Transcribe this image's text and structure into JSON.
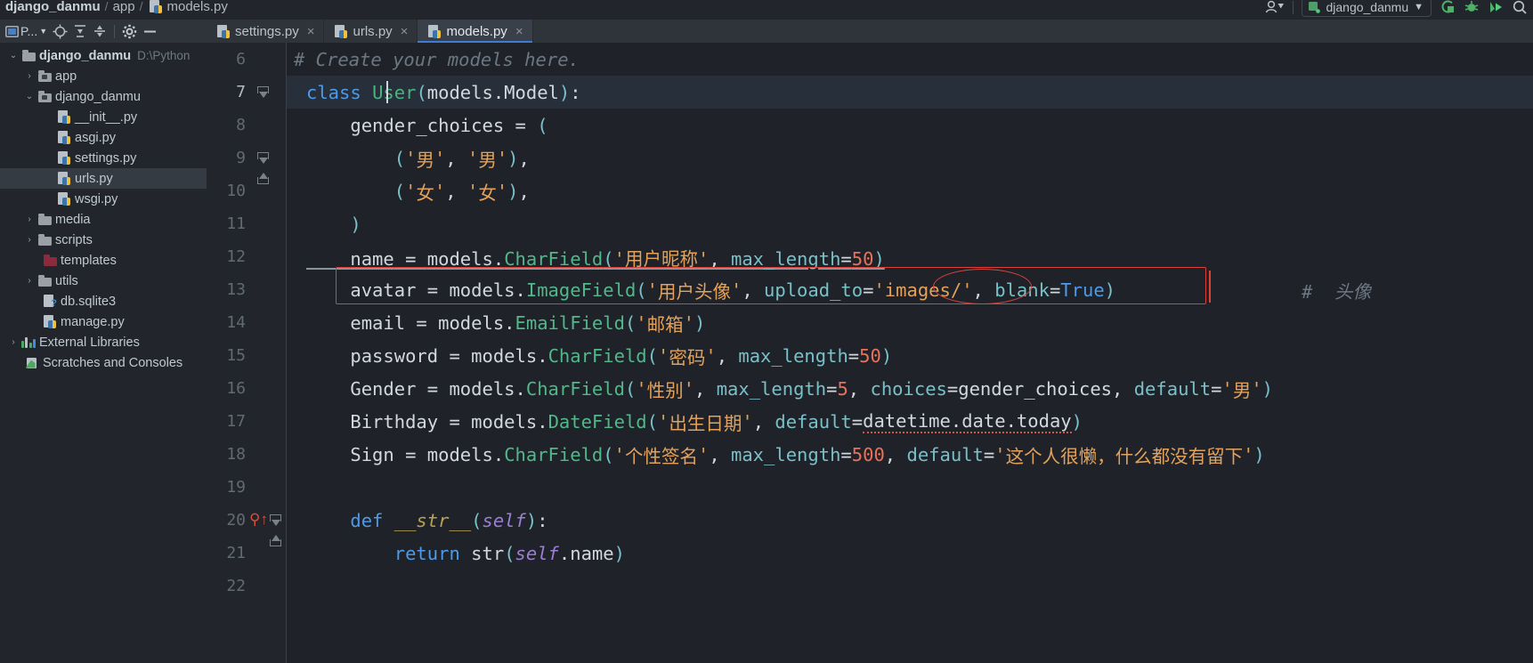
{
  "window": {
    "breadcrumb": [
      "django_danmu",
      "app",
      "models.py"
    ],
    "run_config": "django_danmu",
    "icons": [
      "avatar-icon",
      "chevron-down-icon",
      "coverage-icon",
      "debug-icon",
      "run-icon",
      "search-icon"
    ]
  },
  "project_panel": {
    "title": "P...",
    "buttons": [
      "project-view-selector",
      "locate-icon",
      "expand-all-icon",
      "collapse-all-icon",
      "settings-gear-icon",
      "hide-panel-icon"
    ]
  },
  "tabs": [
    {
      "label": "settings.py",
      "icon": "python-file-icon",
      "active": false,
      "close": "×"
    },
    {
      "label": "urls.py",
      "icon": "python-file-icon",
      "active": false,
      "close": "×"
    },
    {
      "label": "models.py",
      "icon": "python-file-icon",
      "active": true,
      "close": "×"
    }
  ],
  "tree": [
    {
      "label": "django_danmu",
      "path": "D:\\Python",
      "icon": "folder-icon",
      "arrow": "⌄",
      "indent": 8,
      "bold": true,
      "selected": false
    },
    {
      "label": "app",
      "path": "",
      "icon": "folder-source-icon",
      "arrow": "›",
      "indent": 26,
      "bold": false,
      "selected": false
    },
    {
      "label": "django_danmu",
      "path": "",
      "icon": "folder-source-icon",
      "arrow": "⌄",
      "indent": 26,
      "bold": false,
      "selected": false
    },
    {
      "label": "__init__.py",
      "path": "",
      "icon": "python-file-icon",
      "arrow": "",
      "indent": 58,
      "bold": false,
      "selected": false
    },
    {
      "label": "asgi.py",
      "path": "",
      "icon": "python-file-icon",
      "arrow": "",
      "indent": 58,
      "bold": false,
      "selected": false
    },
    {
      "label": "settings.py",
      "path": "",
      "icon": "python-file-icon",
      "arrow": "",
      "indent": 58,
      "bold": false,
      "selected": false
    },
    {
      "label": "urls.py",
      "path": "",
      "icon": "python-file-icon",
      "arrow": "",
      "indent": 58,
      "bold": false,
      "selected": true
    },
    {
      "label": "wsgi.py",
      "path": "",
      "icon": "python-file-icon",
      "arrow": "",
      "indent": 58,
      "bold": false,
      "selected": false
    },
    {
      "label": "media",
      "path": "",
      "icon": "folder-icon",
      "arrow": "›",
      "indent": 26,
      "bold": false,
      "selected": false
    },
    {
      "label": "scripts",
      "path": "",
      "icon": "folder-icon",
      "arrow": "›",
      "indent": 26,
      "bold": false,
      "selected": false
    },
    {
      "label": "templates",
      "path": "",
      "icon": "folder-template-icon",
      "arrow": "",
      "indent": 42,
      "bold": false,
      "selected": false
    },
    {
      "label": "utils",
      "path": "",
      "icon": "folder-icon",
      "arrow": "›",
      "indent": 26,
      "bold": false,
      "selected": false
    },
    {
      "label": "db.sqlite3",
      "path": "",
      "icon": "unknown-file-icon",
      "arrow": "",
      "indent": 42,
      "bold": false,
      "selected": false
    },
    {
      "label": "manage.py",
      "path": "",
      "icon": "python-file-icon",
      "arrow": "",
      "indent": 42,
      "bold": false,
      "selected": false
    },
    {
      "label": "External Libraries",
      "path": "",
      "icon": "library-icon",
      "arrow": "›",
      "indent": 8,
      "bold": false,
      "selected": false
    },
    {
      "label": "Scratches and Consoles",
      "path": "",
      "icon": "scratch-icon",
      "arrow": "",
      "indent": 24,
      "bold": false,
      "selected": false
    }
  ],
  "editor": {
    "file": "models.py",
    "current_line": 7,
    "first_visible_line": 6,
    "lines": [
      {
        "n": 6,
        "text": "    # Create your models here."
      },
      {
        "n": 7,
        "text": "class User(models.Model):"
      },
      {
        "n": 8,
        "text": "        gender_choices = ("
      },
      {
        "n": 9,
        "text": "            ('男', '男'),"
      },
      {
        "n": 10,
        "text": "            ('女', '女'),"
      },
      {
        "n": 11,
        "text": "        )"
      },
      {
        "n": 12,
        "text": "        name = models.CharField('用户昵称', max_length=50)"
      },
      {
        "n": 13,
        "text": "        avatar = models.ImageField('用户头像', upload_to='images/', blank=True)    # 头像"
      },
      {
        "n": 14,
        "text": "        email = models.EmailField('邮箱')"
      },
      {
        "n": 15,
        "text": "        password = models.CharField('密码', max_length=50)"
      },
      {
        "n": 16,
        "text": "        Gender = models.CharField('性别', max_length=5, choices=gender_choices, default='男')"
      },
      {
        "n": 17,
        "text": "        Birthday = models.DateField('出生日期', default=datetime.date.today)"
      },
      {
        "n": 18,
        "text": "        Sign = models.CharField('个性签名', max_length=500, default='这个人很懒，什么都没有留下')"
      },
      {
        "n": 19,
        "text": ""
      },
      {
        "n": 20,
        "text": "        def __str__(self):"
      },
      {
        "n": 21,
        "text": "            return str(self.name)"
      },
      {
        "n": 22,
        "text": ""
      }
    ],
    "tokens": {
      "comment_6": "# Create your models here.",
      "keyword_class": "class",
      "classname_user": "User",
      "base_models_model": "models.Model",
      "gender_choices": "gender_choices",
      "male": "男",
      "female": "女",
      "field_name": "name",
      "field_avatar": "avatar",
      "field_email": "email",
      "field_password": "password",
      "field_gender": "Gender",
      "field_birthday": "Birthday",
      "field_sign": "Sign",
      "charfield": "CharField",
      "imagefield": "ImageField",
      "emailfield": "EmailField",
      "datefield": "DateField",
      "label_nickname": "用户昵称",
      "label_avatar": "用户头像",
      "label_email": "邮箱",
      "label_password": "密码",
      "label_gender": "性别",
      "label_birthday": "出生日期",
      "label_sign": "个性签名",
      "upload_to_value": "images/",
      "max_length_50": "50",
      "max_length_5": "5",
      "max_length_500": "500",
      "blank_true": "True",
      "default_male": "男",
      "default_today": "datetime.date.today",
      "default_sign": "这个人很懒，什么都没有留下",
      "trailing_comment": "#  头像",
      "keyword_def": "def",
      "dunder_str": "__str__",
      "self": "self",
      "keyword_return": "return",
      "builtin_str": "str",
      "attr_name": "name"
    },
    "annotations": {
      "avatar_line_box": "red-rectangle-around-avatar-line",
      "images_ellipse": "red-ellipse-around-images-path",
      "comment_divider": "red-vertical-line-before-comment"
    }
  },
  "colors": {
    "background": "#1f2329",
    "panel": "#22262c",
    "toolbar": "#2f343b",
    "tab_active": "#3a4049",
    "accent_blue": "#3d7bd4",
    "keyword": "#4d9ae8",
    "class": "#4bb281",
    "string": "#e3a15b",
    "number": "#e8725a",
    "comment": "#6c7782",
    "annotation_red": "#d9433a",
    "template_folder": "#8c2b3e"
  }
}
